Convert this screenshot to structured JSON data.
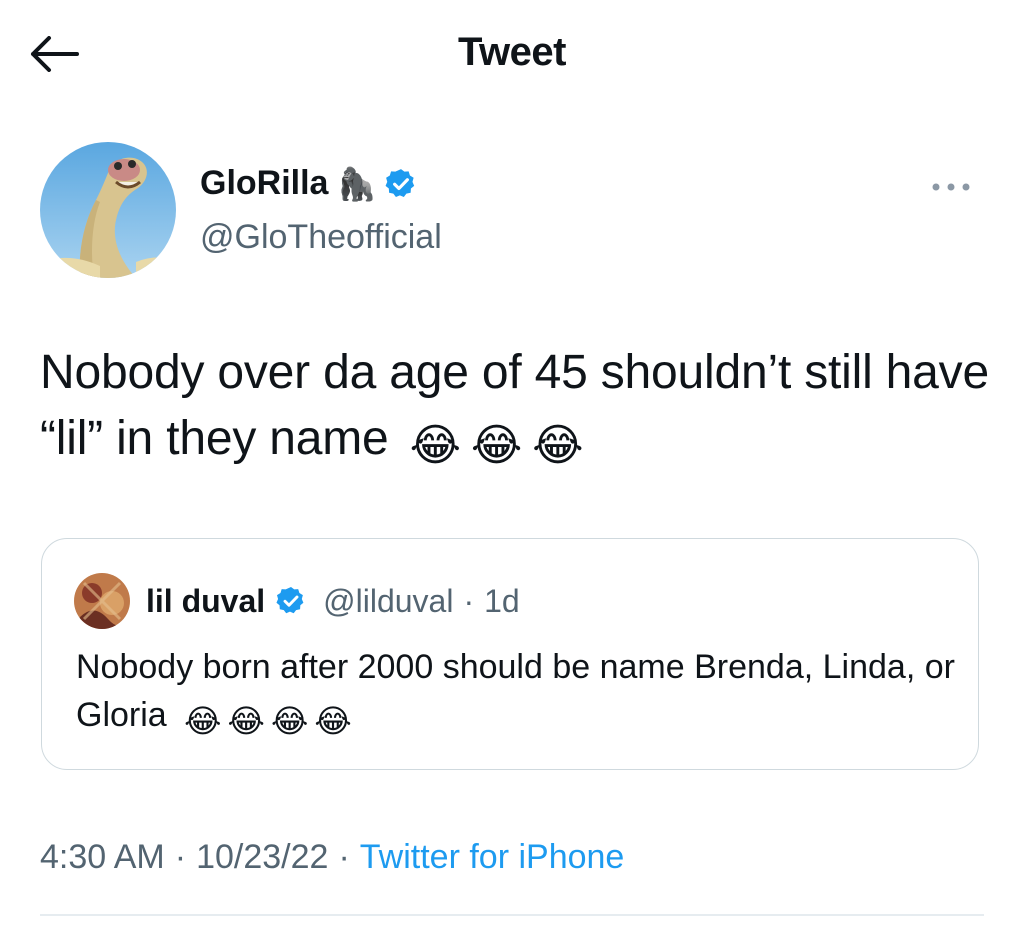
{
  "header": {
    "title": "Tweet",
    "back_icon": "arrow-left-icon"
  },
  "tweet": {
    "author": {
      "display_name": "GloRilla",
      "name_emoji": "🦍",
      "verified_icon": "verified-badge-icon",
      "handle": "@GloTheofficial"
    },
    "more_icon": "more-dots-icon",
    "text": "Nobody over da age of 45 shouldn’t still have “lil” in they name",
    "text_emojis": [
      "😂",
      "😂",
      "😂"
    ],
    "quoted": {
      "display_name": "lil duval",
      "verified_icon": "verified-badge-icon",
      "handle": "@lilduval",
      "separator": "·",
      "time": "1d",
      "text": "Nobody born after 2000 should be name Brenda, Linda, or Gloria",
      "text_emojis": [
        "😂",
        "😂",
        "😂",
        "😂"
      ]
    },
    "meta": {
      "time": "4:30 AM",
      "separator": "·",
      "date": "10/23/22",
      "source": "Twitter for iPhone"
    }
  },
  "colors": {
    "text": "#0f1419",
    "secondary": "#536471",
    "accent": "#1d9bf0",
    "border": "#cfd9de"
  }
}
